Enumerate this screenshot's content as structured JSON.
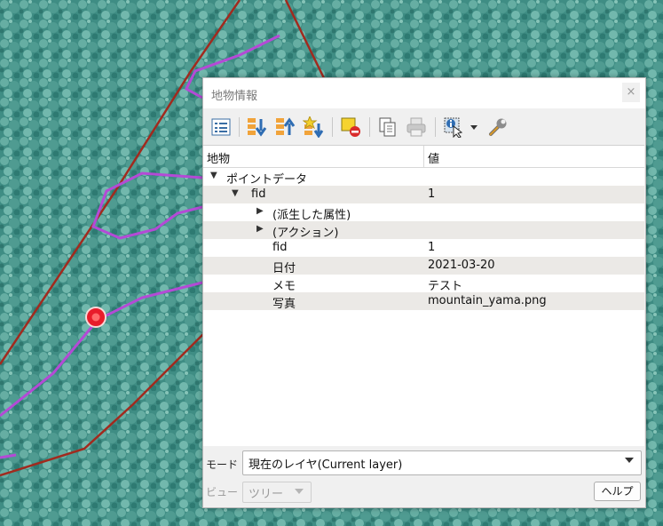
{
  "window": {
    "title": "地物情報",
    "close_label": "×"
  },
  "toolbar": {
    "icons": [
      "expand-tree-icon",
      "expand-all-icon",
      "collapse-all-icon",
      "expand-new-icon",
      "clear-highlight-icon",
      "copy-icon",
      "print-icon",
      "identify-select-icon",
      "settings-icon"
    ]
  },
  "tree": {
    "headers": {
      "feature": "地物",
      "value": "値"
    },
    "rows": [
      {
        "key": "ポイントデータ",
        "value": "",
        "expanded": true
      },
      {
        "key": "fid",
        "value": "1",
        "expanded": true
      },
      {
        "key": "(派生した属性)",
        "value": "",
        "expanded": false
      },
      {
        "key": "(アクション)",
        "value": "",
        "expanded": false
      },
      {
        "key": "fid",
        "value": "1"
      },
      {
        "key": "日付",
        "value": "2021-03-20"
      },
      {
        "key": "メモ",
        "value": "テスト"
      },
      {
        "key": "写真",
        "value": "mountain_yama.png"
      }
    ]
  },
  "bottom": {
    "mode_label": "モード",
    "mode_value": "現在のレイヤ(Current layer)",
    "view_label": "ビュー",
    "view_value": "ツリー",
    "help_label": "ヘルプ"
  },
  "colors": {
    "boundary": "#a12a1e",
    "track": "#b44ad6",
    "point": "#e81c2a"
  }
}
